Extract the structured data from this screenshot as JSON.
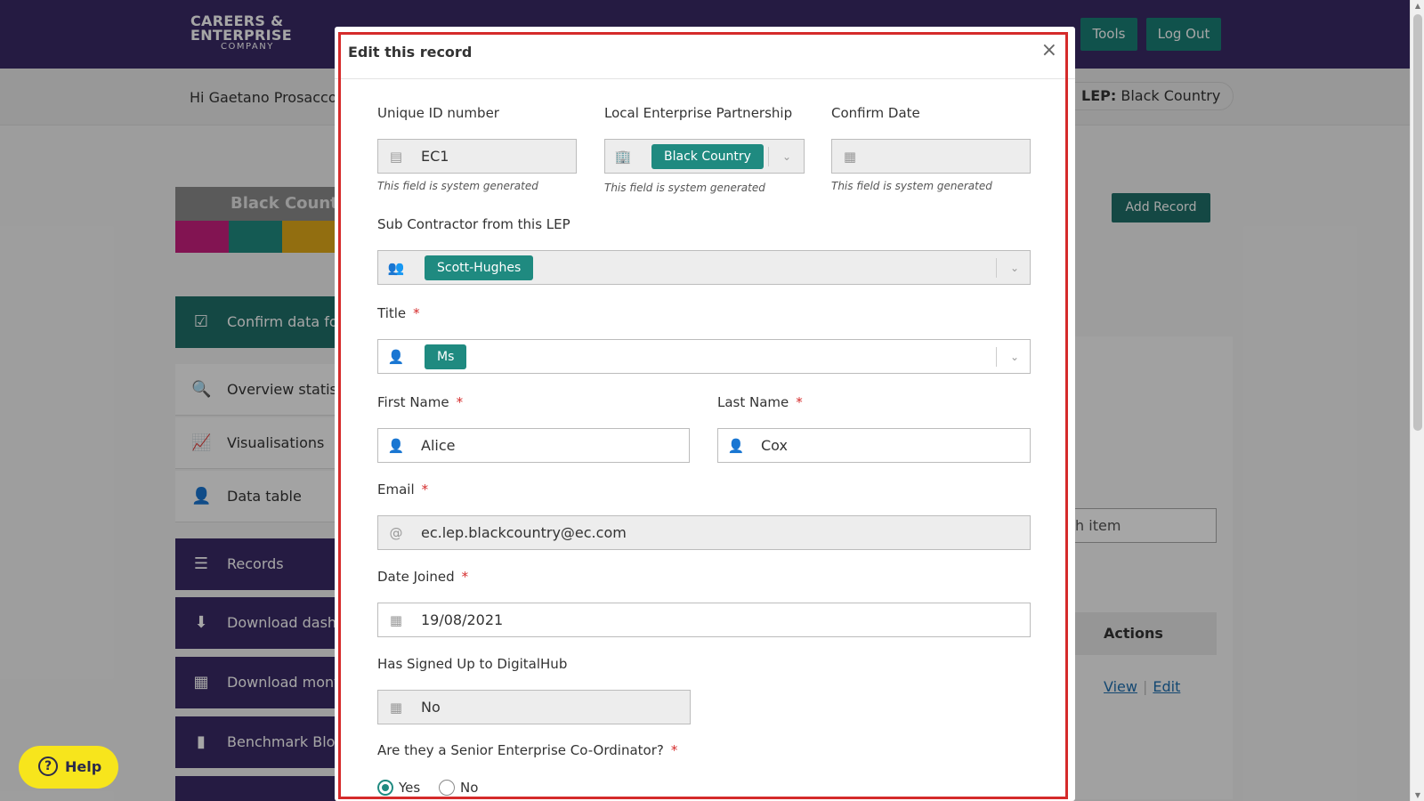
{
  "header": {
    "logo": {
      "line1": "CAREERS &",
      "line2": "ENTERPRISE",
      "line3": "COMPANY"
    },
    "tools_label": "Tools",
    "logout_label": "Log Out"
  },
  "subheader": {
    "greeting": "Hi Gaetano Prosacco K",
    "lep_label": "LEP:",
    "lep_value": "Black Country"
  },
  "lep_card": {
    "title": "Black Count",
    "colors": [
      "#c8207e",
      "#1f8a80",
      "#e0a91a"
    ]
  },
  "sidebar": {
    "items": [
      {
        "label": "Confirm data for",
        "icon": "calendar-check-icon"
      },
      {
        "label": "Overview statist",
        "icon": "search-list-icon"
      },
      {
        "label": "Visualisations",
        "icon": "chart-icon"
      },
      {
        "label": "Data table",
        "icon": "user-table-icon"
      },
      {
        "label": "Records",
        "icon": "list-icon"
      },
      {
        "label": "Download dashb",
        "icon": "download-icon"
      },
      {
        "label": "Download montl",
        "icon": "calendar-icon"
      },
      {
        "label": "Benchmark Bloc",
        "icon": "bar-chart-icon"
      }
    ]
  },
  "page": {
    "add_record_label": "Add Record",
    "search_placeholder": "rch item",
    "actions_header": "Actions",
    "row_links": {
      "view": "View",
      "edit": "Edit"
    }
  },
  "help_label": "Help",
  "modal": {
    "title": "Edit this record",
    "close_glyph": "×",
    "system_hint": "This field is system generated",
    "fields": {
      "unique_id": {
        "label": "Unique ID number",
        "value": "EC1"
      },
      "lep": {
        "label": "Local Enterprise Partnership",
        "value": "Black Country"
      },
      "confirm_date": {
        "label": "Confirm Date",
        "value": ""
      },
      "sub_contractor": {
        "label": "Sub Contractor from this LEP",
        "value": "Scott-Hughes"
      },
      "title": {
        "label": "Title",
        "value": "Ms",
        "required_mark": "*"
      },
      "first_name": {
        "label": "First Name",
        "value": "Alice",
        "required_mark": "*"
      },
      "last_name": {
        "label": "Last Name",
        "value": "Cox",
        "required_mark": "*"
      },
      "email": {
        "label": "Email",
        "value": "ec.lep.blackcountry@ec.com",
        "required_mark": "*"
      },
      "date_joined": {
        "label": "Date Joined",
        "value": "19/08/2021",
        "required_mark": "*"
      },
      "digitalhub": {
        "label": "Has Signed Up to DigitalHub",
        "value": "No"
      },
      "senior_coordinator": {
        "label": "Are they a Senior Enterprise Co-Ordinator?",
        "required_mark": "*",
        "options": [
          "Yes",
          "No"
        ],
        "selected": "Yes"
      }
    }
  }
}
